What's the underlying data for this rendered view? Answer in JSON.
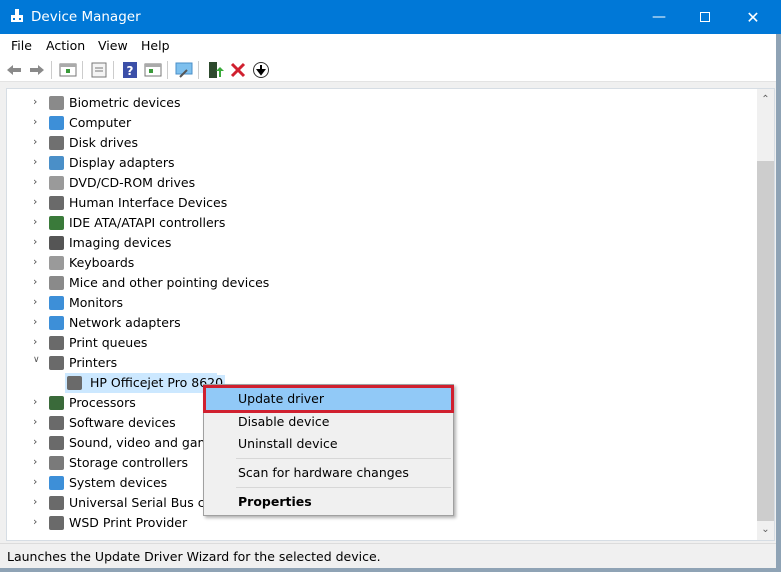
{
  "window": {
    "title": "Device Manager",
    "controls": [
      "minimize",
      "maximize",
      "close"
    ]
  },
  "menu": [
    "File",
    "Action",
    "View",
    "Help"
  ],
  "toolbar": [
    "back-icon",
    "forward-icon",
    "show-hide-console-tree-icon",
    "properties-icon",
    "help-icon",
    "action-pane-icon",
    "scan-hardware-icon",
    "update-driver-icon",
    "uninstall-icon",
    "disable-icon"
  ],
  "tree": {
    "items": [
      {
        "label": "Biometric devices",
        "icon": "fingerprint-icon",
        "color": "#8a8a8a",
        "expanded": false
      },
      {
        "label": "Computer",
        "icon": "computer-icon",
        "color": "#3d8fd8",
        "expanded": false
      },
      {
        "label": "Disk drives",
        "icon": "disk-drive-icon",
        "color": "#707070",
        "expanded": false
      },
      {
        "label": "Display adapters",
        "icon": "display-adapter-icon",
        "color": "#4a8fc8",
        "expanded": false
      },
      {
        "label": "DVD/CD-ROM drives",
        "icon": "dvd-icon",
        "color": "#9a9a9a",
        "expanded": false
      },
      {
        "label": "Human Interface Devices",
        "icon": "hid-icon",
        "color": "#6a6a6a",
        "expanded": false
      },
      {
        "label": "IDE ATA/ATAPI controllers",
        "icon": "ide-controller-icon",
        "color": "#3a7a3a",
        "expanded": false
      },
      {
        "label": "Imaging devices",
        "icon": "camera-icon",
        "color": "#555555",
        "expanded": false
      },
      {
        "label": "Keyboards",
        "icon": "keyboard-icon",
        "color": "#9a9a9a",
        "expanded": false
      },
      {
        "label": "Mice and other pointing devices",
        "icon": "mouse-icon",
        "color": "#8a8a8a",
        "expanded": false
      },
      {
        "label": "Monitors",
        "icon": "monitor-icon",
        "color": "#3d8fd8",
        "expanded": false
      },
      {
        "label": "Network adapters",
        "icon": "network-adapter-icon",
        "color": "#3d8fd8",
        "expanded": false
      },
      {
        "label": "Print queues",
        "icon": "print-queue-icon",
        "color": "#6a6a6a",
        "expanded": false
      },
      {
        "label": "Printers",
        "icon": "printer-icon",
        "color": "#6a6a6a",
        "expanded": true,
        "children": [
          {
            "label": "HP Officejet Pro 8620",
            "icon": "printer-icon",
            "selected": true
          }
        ]
      },
      {
        "label": "Processors",
        "icon": "processor-icon",
        "color": "#3a6a3a",
        "expanded": false
      },
      {
        "label": "Software devices",
        "icon": "software-device-icon",
        "color": "#6a6a6a",
        "expanded": false
      },
      {
        "label": "Sound, video and game controllers",
        "icon": "speaker-icon",
        "color": "#6a6a6a",
        "expanded": false
      },
      {
        "label": "Storage controllers",
        "icon": "storage-controller-icon",
        "color": "#7a7a7a",
        "expanded": false
      },
      {
        "label": "System devices",
        "icon": "system-device-icon",
        "color": "#3d8fd8",
        "expanded": false
      },
      {
        "label": "Universal Serial Bus controllers",
        "icon": "usb-icon",
        "color": "#6a6a6a",
        "expanded": false
      },
      {
        "label": "WSD Print Provider",
        "icon": "printer-icon",
        "color": "#6a6a6a",
        "expanded": false
      }
    ]
  },
  "context_menu": {
    "items": [
      "Update driver",
      "Disable device",
      "Uninstall device",
      "Scan for hardware changes",
      "Properties"
    ],
    "highlighted": "Update driver",
    "highlight_color": "#d0202f"
  },
  "status": "Launches the Update Driver Wizard for the selected device."
}
